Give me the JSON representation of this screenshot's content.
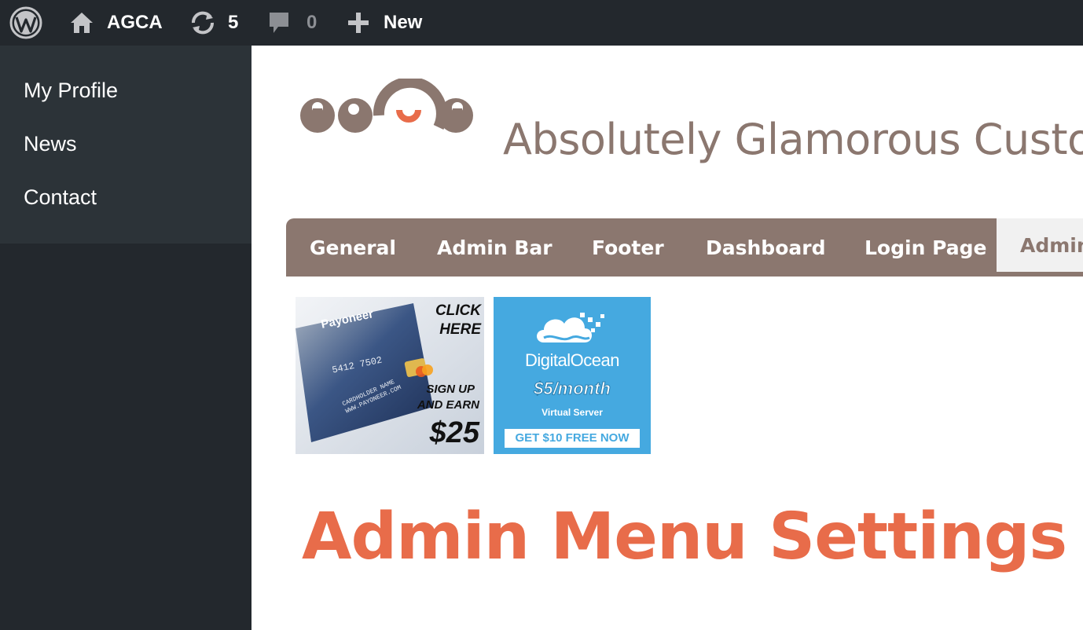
{
  "adminbar": {
    "site_name": "AGCA",
    "updates_count": "5",
    "comments_count": "0",
    "new_label": "New"
  },
  "sidebar": {
    "items": [
      {
        "label": "My Profile"
      },
      {
        "label": "News"
      },
      {
        "label": "Contact"
      }
    ]
  },
  "header": {
    "site_title": "Absolutely Glamorous Custom Admin"
  },
  "tabs": [
    {
      "label": "General"
    },
    {
      "label": "Admin Bar"
    },
    {
      "label": "Footer"
    },
    {
      "label": "Dashboard"
    },
    {
      "label": "Login Page"
    },
    {
      "label": "Admin Menu",
      "active": true
    }
  ],
  "ads": {
    "payoneer": {
      "brand": "Payoneer",
      "cta": "CLICK HERE",
      "line1": "SIGN UP",
      "line2": "AND EARN",
      "amount": "$25",
      "card_number": "5412 7502",
      "card_lines": "CARDHOLDER NAME WWW.PAYONEER.COM"
    },
    "digitalocean": {
      "brand": "DigitalOcean",
      "price": "$5/month",
      "subtitle": "Virtual Server",
      "cta": "GET $10 FREE NOW"
    }
  },
  "page": {
    "heading": "Admin Menu Settings"
  },
  "colors": {
    "bar_bg": "#23282d",
    "tab_bg": "#8b776f",
    "heading": "#e86c4a",
    "do_blue": "#45a9e0"
  }
}
